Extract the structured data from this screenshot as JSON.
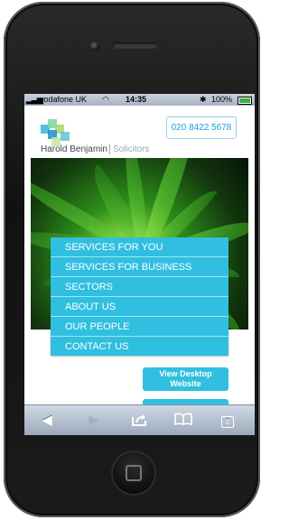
{
  "status_bar": {
    "signal_bars": "▂▃▅",
    "carrier": "vodafone UK",
    "wifi_icon": "◠",
    "time": "14:35",
    "bluetooth_icon": "✱",
    "battery_text": "100%",
    "battery_level": 1.0
  },
  "site": {
    "logo_name": "Harold Benjamin",
    "logo_tagline": "Solicitors",
    "phone": "020 8422 5678",
    "menu": [
      {
        "label": "SERVICES FOR YOU"
      },
      {
        "label": "SERVICES FOR BUSINESS"
      },
      {
        "label": "SECTORS"
      },
      {
        "label": "ABOUT US"
      },
      {
        "label": "OUR PEOPLE"
      },
      {
        "label": "CONTACT US"
      }
    ],
    "desktop_button_line1": "View Desktop",
    "desktop_button_line2": "Website"
  },
  "toolbar": {
    "back_icon": "◀",
    "forward_icon": "▶",
    "share_icon": "⤒",
    "bookmarks_icon": "Ὅ6",
    "pages_count": "8"
  },
  "colors": {
    "accent": "#30bfe0",
    "phone_text": "#1aa2d7",
    "logo_squares": [
      "#33b6d9",
      "#7dd3a7",
      "#a8d86a",
      "#1f8fc7",
      "#5fc6cf",
      "#c6e8a2"
    ]
  }
}
